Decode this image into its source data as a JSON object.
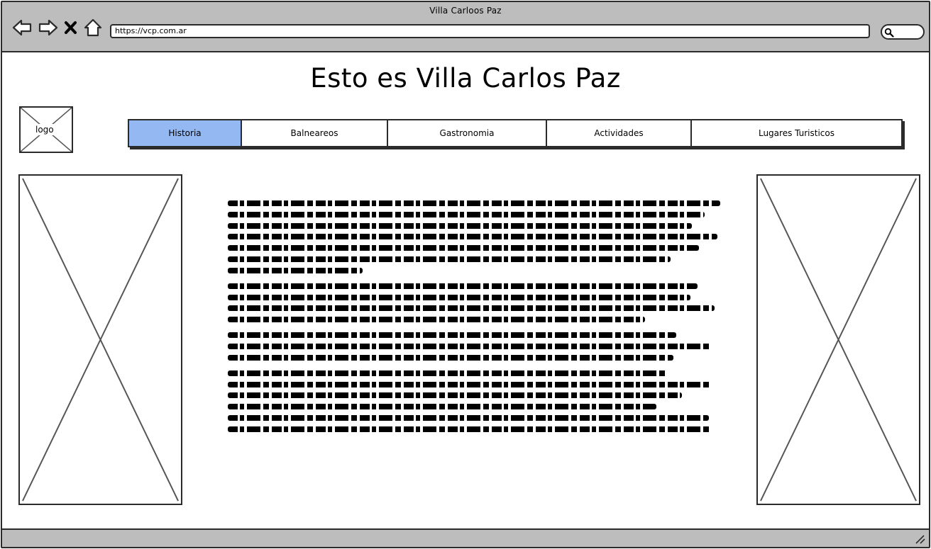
{
  "window": {
    "title": "Villa Carloos Paz",
    "url": "https://vcp.com.ar",
    "chrome_color": "#bdbdbd"
  },
  "toolbar": {
    "buttons": [
      "back-arrow-icon",
      "forward-arrow-icon",
      "close-x-icon",
      "home-icon"
    ],
    "search_icon": "search-icon"
  },
  "page": {
    "title": "Esto es Villa Carlos Paz",
    "logo_label": "logo"
  },
  "tabs": [
    {
      "label": "Historia",
      "active": true
    },
    {
      "label": "Balneareos",
      "active": false
    },
    {
      "label": "Gastronomia",
      "active": false
    },
    {
      "label": "Actividades",
      "active": false
    },
    {
      "label": "Lugares Turisticos",
      "active": false
    }
  ],
  "colors": {
    "active_tab": "#93b8f2",
    "border": "#2b2b2b"
  },
  "content": {
    "paragraph_line_counts": [
      7,
      4,
      3,
      6
    ]
  }
}
